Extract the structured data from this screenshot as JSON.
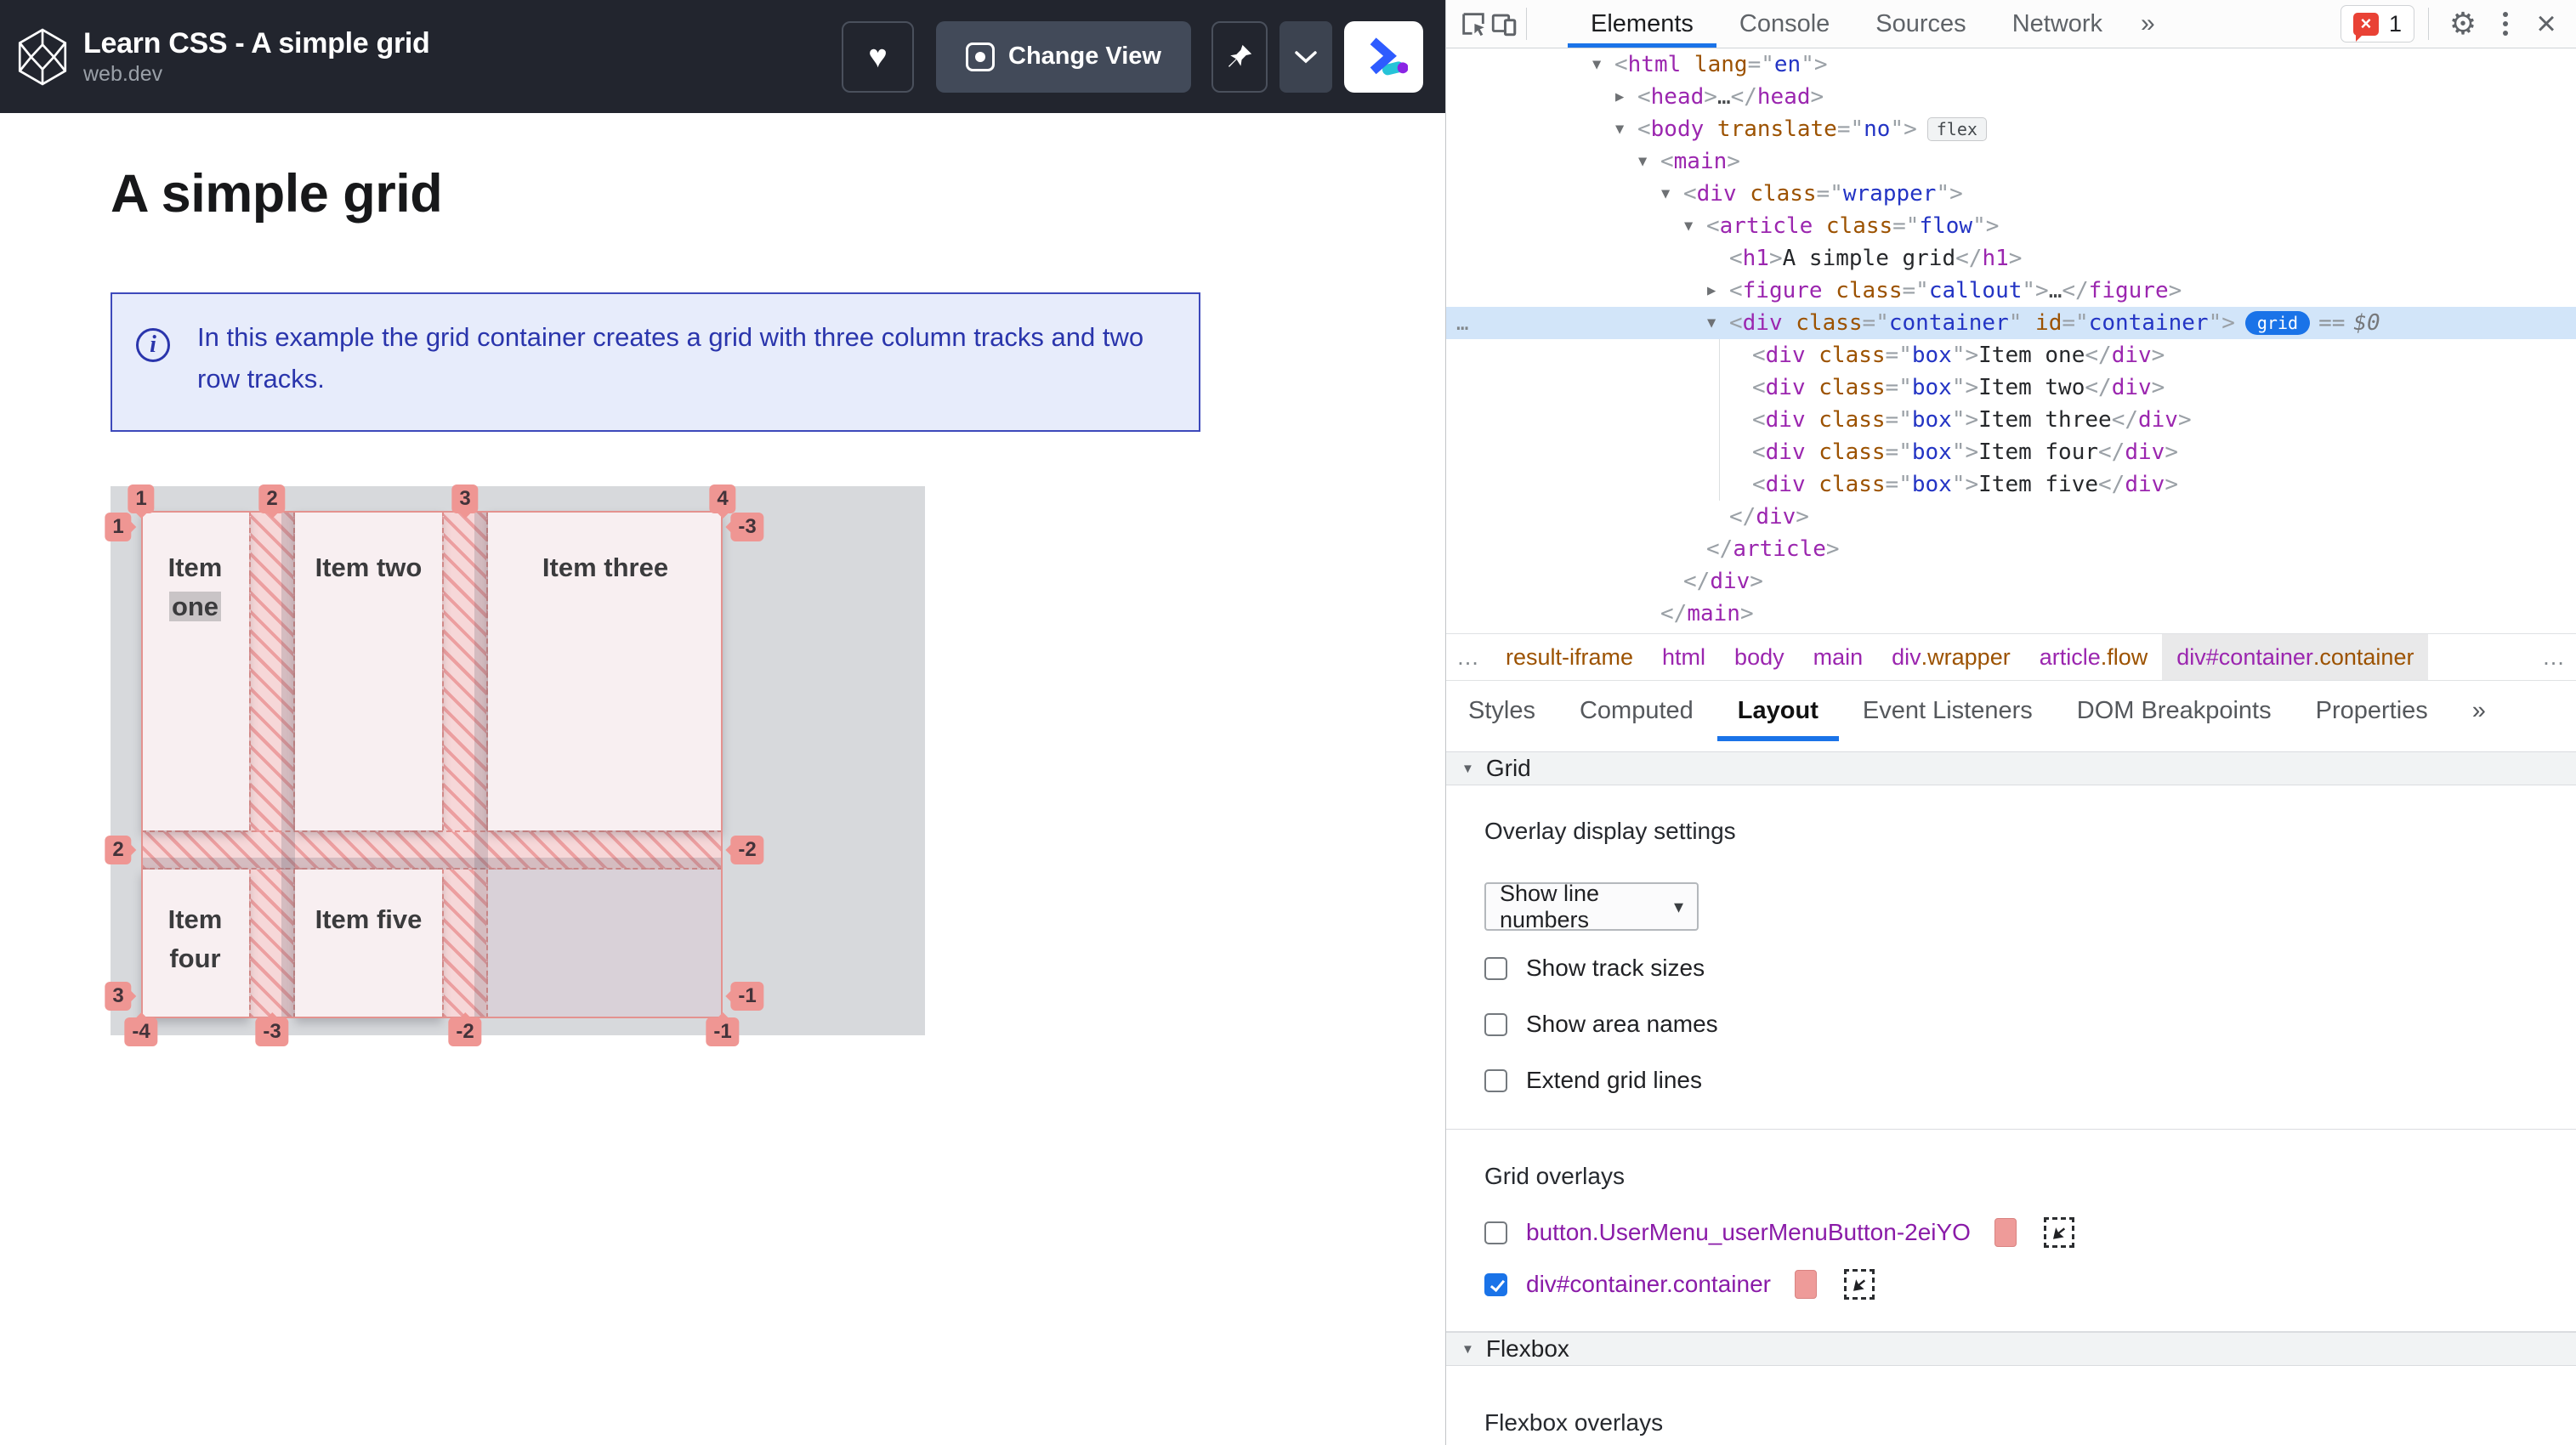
{
  "colors": {
    "accent_blue": "#1a73e8",
    "overlay_salmon": "#ee9b99",
    "selection_blue": "#d2e5f9",
    "error_red": "#e94235",
    "callout_blue": "#2a35ac"
  },
  "app": {
    "header": {
      "title": "Learn CSS - A simple grid",
      "site": "web.dev",
      "buttons": {
        "change_view": "Change View"
      }
    },
    "page": {
      "heading": "A simple grid",
      "callout_text": "In this example the grid container creates a grid with three column tracks and two row tracks."
    },
    "grid": {
      "items": [
        {
          "prefix": "Item ",
          "highlight": "one"
        },
        {
          "label": "Item two"
        },
        {
          "label": "Item three"
        },
        {
          "label": "Item four"
        },
        {
          "label": "Item five"
        }
      ],
      "badges": {
        "top": [
          "1",
          "2",
          "3",
          "4"
        ],
        "left": [
          "1",
          "2",
          "3"
        ],
        "right": [
          "-3",
          "-2",
          "-1"
        ],
        "bottom": [
          "-4",
          "-3",
          "-2",
          "-1"
        ]
      }
    }
  },
  "devtools": {
    "toolbar": {
      "tabs": [
        "Elements",
        "Console",
        "Sources",
        "Network"
      ],
      "more": "»",
      "error_count": "1"
    },
    "dom_lines": [
      {
        "d": 0,
        "arrow": "▼",
        "parts": [
          [
            "br",
            "<"
          ],
          [
            "tag",
            "html"
          ],
          [
            "attr",
            " lang"
          ],
          [
            "br",
            "=\""
          ],
          [
            "val",
            "en"
          ],
          [
            "br",
            "\">"
          ]
        ]
      },
      {
        "d": 1,
        "arrow": "▶",
        "parts": [
          [
            "br",
            "<"
          ],
          [
            "tag",
            "head"
          ],
          [
            "br",
            ">"
          ],
          [
            "dots",
            "…"
          ],
          [
            "br",
            "</"
          ],
          [
            "tag",
            "head"
          ],
          [
            "br",
            ">"
          ]
        ]
      },
      {
        "d": 1,
        "arrow": "▼",
        "parts": [
          [
            "br",
            "<"
          ],
          [
            "tag",
            "body"
          ],
          [
            "attr",
            " translate"
          ],
          [
            "br",
            "=\""
          ],
          [
            "val",
            "no"
          ],
          [
            "br",
            "\">"
          ],
          [
            "bflex",
            "flex"
          ]
        ]
      },
      {
        "d": 2,
        "arrow": "▼",
        "parts": [
          [
            "br",
            "<"
          ],
          [
            "tag",
            "main"
          ],
          [
            "br",
            ">"
          ]
        ]
      },
      {
        "d": 3,
        "arrow": "▼",
        "parts": [
          [
            "br",
            "<"
          ],
          [
            "tag",
            "div"
          ],
          [
            "attr",
            " class"
          ],
          [
            "br",
            "=\""
          ],
          [
            "val",
            "wrapper"
          ],
          [
            "br",
            "\">"
          ]
        ]
      },
      {
        "d": 4,
        "arrow": "▼",
        "parts": [
          [
            "br",
            "<"
          ],
          [
            "tag",
            "article"
          ],
          [
            "attr",
            " class"
          ],
          [
            "br",
            "=\""
          ],
          [
            "val",
            "flow"
          ],
          [
            "br",
            "\">"
          ]
        ]
      },
      {
        "d": 5,
        "arrow": "",
        "parts": [
          [
            "br",
            "<"
          ],
          [
            "tag",
            "h1"
          ],
          [
            "br",
            ">"
          ],
          [
            "txt",
            "A simple grid"
          ],
          [
            "br",
            "</"
          ],
          [
            "tag",
            "h1"
          ],
          [
            "br",
            ">"
          ]
        ]
      },
      {
        "d": 5,
        "arrow": "▶",
        "parts": [
          [
            "br",
            "<"
          ],
          [
            "tag",
            "figure"
          ],
          [
            "attr",
            " class"
          ],
          [
            "br",
            "=\""
          ],
          [
            "val",
            "callout"
          ],
          [
            "br",
            "\">"
          ],
          [
            "dots",
            "…"
          ],
          [
            "br",
            "</"
          ],
          [
            "tag",
            "figure"
          ],
          [
            "br",
            ">"
          ]
        ]
      },
      {
        "d": 5,
        "arrow": "▼",
        "sel": true,
        "gutter": "…",
        "parts": [
          [
            "br",
            "<"
          ],
          [
            "tag",
            "div"
          ],
          [
            "attr",
            " class"
          ],
          [
            "br",
            "=\""
          ],
          [
            "val",
            "container"
          ],
          [
            "br",
            "\""
          ],
          [
            "attr",
            " id"
          ],
          [
            "br",
            "=\""
          ],
          [
            "val",
            "container"
          ],
          [
            "br",
            "\">"
          ],
          [
            "bgrid",
            "grid"
          ],
          [
            "eq",
            "=="
          ],
          [
            "dollar",
            "$0"
          ]
        ]
      },
      {
        "d": 6,
        "arrow": "",
        "parts": [
          [
            "br",
            "<"
          ],
          [
            "tag",
            "div"
          ],
          [
            "attr",
            " class"
          ],
          [
            "br",
            "=\""
          ],
          [
            "val",
            "box"
          ],
          [
            "br",
            "\">"
          ],
          [
            "txt",
            "Item one"
          ],
          [
            "br",
            "</"
          ],
          [
            "tag",
            "div"
          ],
          [
            "br",
            ">"
          ]
        ]
      },
      {
        "d": 6,
        "arrow": "",
        "parts": [
          [
            "br",
            "<"
          ],
          [
            "tag",
            "div"
          ],
          [
            "attr",
            " class"
          ],
          [
            "br",
            "=\""
          ],
          [
            "val",
            "box"
          ],
          [
            "br",
            "\">"
          ],
          [
            "txt",
            "Item two"
          ],
          [
            "br",
            "</"
          ],
          [
            "tag",
            "div"
          ],
          [
            "br",
            ">"
          ]
        ]
      },
      {
        "d": 6,
        "arrow": "",
        "parts": [
          [
            "br",
            "<"
          ],
          [
            "tag",
            "div"
          ],
          [
            "attr",
            " class"
          ],
          [
            "br",
            "=\""
          ],
          [
            "val",
            "box"
          ],
          [
            "br",
            "\">"
          ],
          [
            "txt",
            "Item three"
          ],
          [
            "br",
            "</"
          ],
          [
            "tag",
            "div"
          ],
          [
            "br",
            ">"
          ]
        ]
      },
      {
        "d": 6,
        "arrow": "",
        "parts": [
          [
            "br",
            "<"
          ],
          [
            "tag",
            "div"
          ],
          [
            "attr",
            " class"
          ],
          [
            "br",
            "=\""
          ],
          [
            "val",
            "box"
          ],
          [
            "br",
            "\">"
          ],
          [
            "txt",
            "Item four"
          ],
          [
            "br",
            "</"
          ],
          [
            "tag",
            "div"
          ],
          [
            "br",
            ">"
          ]
        ]
      },
      {
        "d": 6,
        "arrow": "",
        "parts": [
          [
            "br",
            "<"
          ],
          [
            "tag",
            "div"
          ],
          [
            "attr",
            " class"
          ],
          [
            "br",
            "=\""
          ],
          [
            "val",
            "box"
          ],
          [
            "br",
            "\">"
          ],
          [
            "txt",
            "Item five"
          ],
          [
            "br",
            "</"
          ],
          [
            "tag",
            "div"
          ],
          [
            "br",
            ">"
          ]
        ]
      },
      {
        "d": 5,
        "arrow": "",
        "parts": [
          [
            "br",
            "</"
          ],
          [
            "tag",
            "div"
          ],
          [
            "br",
            ">"
          ]
        ]
      },
      {
        "d": 4,
        "arrow": "",
        "parts": [
          [
            "br",
            "</"
          ],
          [
            "tag",
            "article"
          ],
          [
            "br",
            ">"
          ]
        ]
      },
      {
        "d": 3,
        "arrow": "",
        "parts": [
          [
            "br",
            "</"
          ],
          [
            "tag",
            "div"
          ],
          [
            "br",
            ">"
          ]
        ]
      },
      {
        "d": 2,
        "arrow": "",
        "parts": [
          [
            "br",
            "</"
          ],
          [
            "tag",
            "main"
          ],
          [
            "br",
            ">"
          ]
        ]
      }
    ],
    "breadcrumbs": {
      "left_dots": "…",
      "right_dots": "…",
      "crumbs": [
        {
          "parts": [
            [
              "bc-extra",
              "result-iframe"
            ]
          ]
        },
        {
          "parts": [
            [
              "bc-tag",
              "html"
            ]
          ]
        },
        {
          "parts": [
            [
              "bc-tag",
              "body"
            ]
          ]
        },
        {
          "parts": [
            [
              "bc-tag",
              "main"
            ]
          ]
        },
        {
          "parts": [
            [
              "bc-tag",
              "div"
            ],
            [
              "bc-extra",
              ".wrapper"
            ]
          ]
        },
        {
          "parts": [
            [
              "bc-tag",
              "article"
            ],
            [
              "bc-extra",
              ".flow"
            ]
          ]
        },
        {
          "sel": true,
          "parts": [
            [
              "bc-tag",
              "div"
            ],
            [
              "bc-tag",
              "#container"
            ],
            [
              "bc-extra",
              ".container"
            ]
          ]
        }
      ]
    },
    "panel_tabs": {
      "tabs": [
        "Styles",
        "Computed",
        "Layout",
        "Event Listeners",
        "DOM Breakpoints",
        "Properties"
      ],
      "active": "Layout",
      "more": "»"
    },
    "layout_panel": {
      "grid_section_title": "Grid",
      "overlay_settings_label": "Overlay display settings",
      "dropdown_value": "Show line numbers",
      "display_options": [
        "Show track sizes",
        "Show area names",
        "Extend grid lines"
      ],
      "grid_overlays_label": "Grid overlays",
      "grid_overlays": [
        {
          "label": "button.UserMenu_userMenuButton-2eiYO",
          "checked": false
        },
        {
          "label": "div#container.container",
          "checked": true
        }
      ],
      "flexbox_section_title": "Flexbox",
      "flexbox_overlays_label": "Flexbox overlays"
    }
  }
}
